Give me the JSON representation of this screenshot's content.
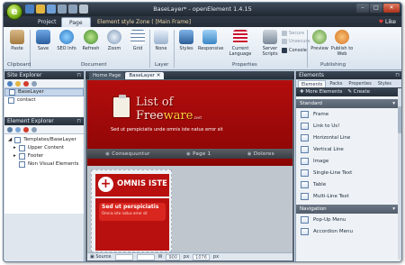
{
  "window": {
    "title": "BaseLayer* - openElement 1.4.15",
    "orb_label": "e"
  },
  "ribbon_tabs": {
    "project": "Project",
    "page": "Page",
    "context": "Element style Zone ( [Main Frame]",
    "like": "Like"
  },
  "ribbon": {
    "paste": "Paste",
    "save": "Save",
    "seo": "SEO Info",
    "refresh": "Refresh",
    "zoom": "Zoom",
    "grid": "Grid",
    "none": "None",
    "styles": "Styles",
    "responsive": "Responsive",
    "current_language": "Current Language",
    "server_scripts": "Server Scripts",
    "secure": "Secure",
    "unsecure": "Unsecure",
    "console": "Console",
    "preview": "Preview",
    "publish": "Publish to Web",
    "groups": {
      "clipboard": "Clipboard",
      "document": "Document",
      "layer": "Layer",
      "properties": "Properties",
      "publishing": "Publishing"
    }
  },
  "site_explorer": {
    "title": "Site Explorer",
    "items": [
      "BaseLayer",
      "contact"
    ]
  },
  "element_explorer": {
    "title": "Element Explorer",
    "root": "Templates/BaseLayer",
    "children": [
      "Upper Content",
      "Footer",
      "Non Visual Elements"
    ]
  },
  "doc_tabs": {
    "home": "Home Page",
    "base": "BaseLayer"
  },
  "canvas": {
    "brand_line1": "List of",
    "brand_line2a": "Free",
    "brand_line2b": "ware",
    "brand_line2c": ".net",
    "tagline": "Sed ut perspiciatis unde omnis iste natus error sit",
    "nav": [
      "Consequuntur",
      "Page 1",
      "Dolores"
    ],
    "card_title": "OMNIS ISTE",
    "card_heading": "Sed ut perspiciatis",
    "card_text": "Omnis iste natus error sit"
  },
  "status": {
    "source": "Source",
    "w_label": "W",
    "w_value": "900",
    "w_unit": "px",
    "h_value": "1076",
    "h_unit": "px"
  },
  "elements_panel": {
    "title": "Elements",
    "tabs": [
      "Elements",
      "Packs",
      "Properties",
      "Styles"
    ],
    "more": "More Elements",
    "create": "Create",
    "standard_label": "Standard",
    "standard": [
      "Frame",
      "Link to Us!",
      "Horizontal Line",
      "Vertical Line",
      "Image",
      "Single-Line Text",
      "Table",
      "Multi-Line Text"
    ],
    "navigation_label": "Navigation",
    "navigation": [
      "Pop-Up Menu",
      "Accordion Menu"
    ]
  },
  "colors": {
    "brand_red": "#b30d0d",
    "accent_yellow": "#ffcf40",
    "panel_header": "#27303b"
  }
}
